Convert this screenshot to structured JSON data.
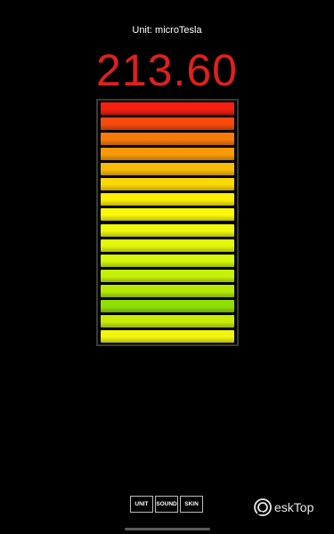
{
  "header": {
    "unit_text": "Unit: microTesla",
    "reading": "213.60",
    "reading_color": "#e0201c"
  },
  "meter": {
    "level_fraction": 1.0,
    "segment_count": 16,
    "segment_colors": [
      "#f5200f",
      "#f64a0c",
      "#f77a0a",
      "#f89a08",
      "#f9bb06",
      "#fad805",
      "#fbee04",
      "#fbf70a",
      "#eef70d",
      "#e2f70b",
      "#d4f70a",
      "#c4f108",
      "#b4ea06",
      "#8fdf04",
      "#c8ec06",
      "#f0f510"
    ]
  },
  "controls": {
    "unit_label": "UNIT",
    "sound_label": "SOUND",
    "skin_label": "SKIN"
  },
  "watermark": {
    "text": "eskTop",
    "icon": "desktop-logo-icon"
  }
}
